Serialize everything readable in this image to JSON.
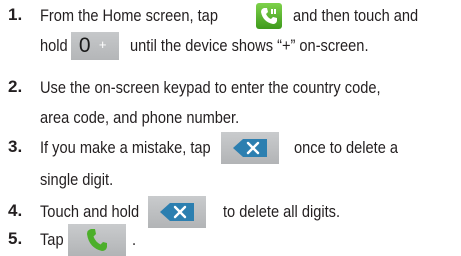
{
  "steps": [
    {
      "number": "1.",
      "line1_a": "From the Home screen, tap",
      "line1_b": "and then touch and",
      "line2_a": "hold",
      "line2_b": "until the device shows “+” on-screen.",
      "icon_app": "phone-app-icon",
      "key_zero_digit": "0",
      "key_zero_plus": "+"
    },
    {
      "number": "2.",
      "line1": "Use the on-screen keypad to enter the country code,",
      "line2": "area code, and phone number."
    },
    {
      "number": "3.",
      "line1_a": "If you make a mistake, tap",
      "line1_b": "once to delete a",
      "line2": "single digit.",
      "icon_key": "backspace-icon"
    },
    {
      "number": "4.",
      "line1_a": "Touch and hold",
      "line1_b": "to delete all digits.",
      "icon_key": "backspace-icon"
    },
    {
      "number": "5.",
      "line1_a": "Tap",
      "line1_b": ".",
      "icon_key": "call-icon"
    }
  ],
  "colors": {
    "text": "#231f20",
    "phone_green": "#4caf2a",
    "key_gray": "#bfc1c3",
    "backspace_blue": "#2c7fb0"
  }
}
